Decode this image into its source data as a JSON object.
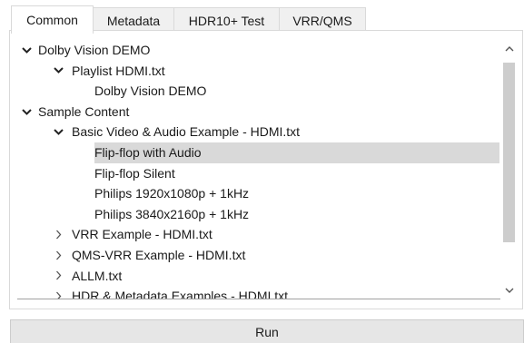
{
  "tabs": [
    {
      "label": "Common",
      "active": true
    },
    {
      "label": "Metadata",
      "active": false
    },
    {
      "label": "HDR10+ Test",
      "active": false
    },
    {
      "label": "VRR/QMS",
      "active": false
    }
  ],
  "tree": {
    "items": [
      {
        "label": "Dolby Vision DEMO",
        "state": "expanded",
        "level": 0
      },
      {
        "label": "Playlist HDMI.txt",
        "state": "expanded",
        "level": 1
      },
      {
        "label": "Dolby Vision DEMO",
        "state": "leaf",
        "level": 2
      },
      {
        "label": "Sample Content",
        "state": "expanded",
        "level": 0
      },
      {
        "label": "Basic Video & Audio Example - HDMI.txt",
        "state": "expanded",
        "level": 1
      },
      {
        "label": "Flip-flop with Audio",
        "state": "leaf",
        "level": 2,
        "selected": true
      },
      {
        "label": "Flip-flop Silent",
        "state": "leaf",
        "level": 2
      },
      {
        "label": "Philips 1920x1080p + 1kHz",
        "state": "leaf",
        "level": 2
      },
      {
        "label": "Philips 3840x2160p + 1kHz",
        "state": "leaf",
        "level": 2
      },
      {
        "label": "VRR Example - HDMI.txt",
        "state": "collapsed",
        "level": 1
      },
      {
        "label": "QMS-VRR Example - HDMI.txt",
        "state": "collapsed",
        "level": 1
      },
      {
        "label": "ALLM.txt",
        "state": "collapsed",
        "level": 1
      },
      {
        "label": "HDR & Metadata Examples - HDMI.txt",
        "state": "collapsed",
        "level": 1
      }
    ]
  },
  "scrollbar": {
    "up_icon": "chevron-up-icon",
    "down_icon": "chevron-down-icon"
  },
  "run_button": {
    "label": "Run"
  },
  "colors": {
    "selection": "#d9d9d9",
    "tab_inactive": "#f0f0f0",
    "button_bg": "#e6e6e6",
    "scroll_thumb": "#cdcdcd"
  }
}
